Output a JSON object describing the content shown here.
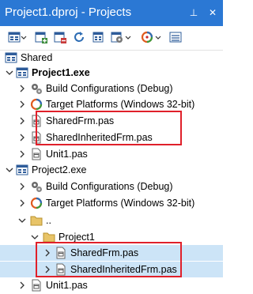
{
  "window": {
    "title": "Project1.dproj - Projects",
    "pin_glyph": "⊥",
    "close_glyph": "✕"
  },
  "toolbar": {
    "buttons": [
      "project-icon",
      "project-dropdown-icon",
      "add-icon",
      "remove-icon",
      "refresh-icon",
      "sync-icon",
      "options-icon",
      "options-dropdown-icon",
      "target-icon",
      "target-dropdown-icon",
      "list-icon"
    ]
  },
  "tree": {
    "shared": "Shared",
    "project1": {
      "label": "Project1.exe",
      "build_config": "Build Configurations (Debug)",
      "target_platforms": "Target Platforms (Windows 32-bit)",
      "shared_frm": "SharedFrm.pas",
      "shared_inherited_frm": "SharedInheritedFrm.pas",
      "unit1": "Unit1.pas"
    },
    "project2": {
      "label": "Project2.exe",
      "build_config": "Build Configurations (Debug)",
      "target_platforms": "Target Platforms (Windows 32-bit)",
      "parent_folder": "..",
      "project1_folder": "Project1",
      "shared_frm": "SharedFrm.pas",
      "shared_inherited_frm": "SharedInheritedFrm.pas",
      "unit1": "Unit1.pas"
    }
  },
  "colors": {
    "title_bg": "#2b78d4",
    "selection_bg": "#cce4f7",
    "highlight_border": "#e0202a"
  }
}
